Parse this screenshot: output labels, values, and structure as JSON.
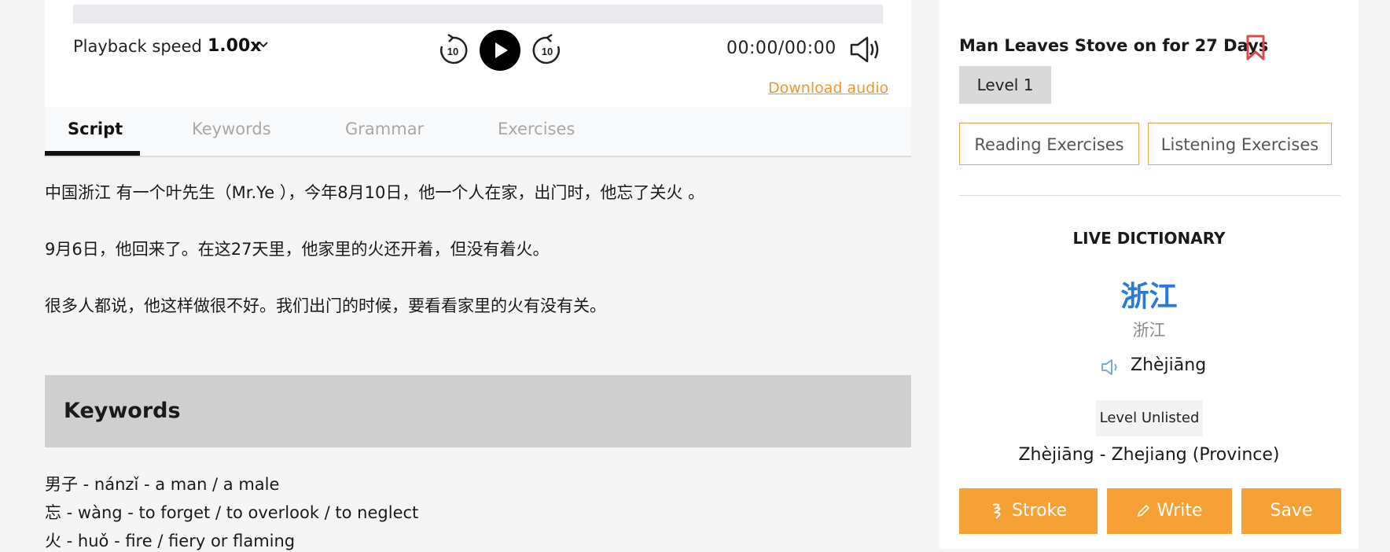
{
  "player": {
    "progress_percent": 0,
    "speed_label": "Playback speed",
    "speed_value": "1.00x",
    "skip_back_label": "10",
    "skip_forward_label": "10",
    "time": "00:00/00:00",
    "download_label": "Download audio"
  },
  "tabs": [
    {
      "label": "Script",
      "active": true
    },
    {
      "label": "Keywords",
      "active": false
    },
    {
      "label": "Grammar",
      "active": false
    },
    {
      "label": "Exercises",
      "active": false
    }
  ],
  "script": [
    "中国浙江 有一个叶先生（Mr.Ye ），今年8月10日，他一个人在家，出门时，他忘了关火 。",
    "9月6日，他回来了。在这27天里，他家里的火还开着，但没有着火。",
    "很多人都说，他这样做很不好。我们出门的时候，要看看家里的火有没有关。"
  ],
  "keywords_section": {
    "title": "Keywords",
    "items": [
      "男子 - nánzǐ - a man / a male",
      "忘 - wàng - to forget / to overlook / to neglect",
      "火 - huǒ - fire / fiery or flaming"
    ]
  },
  "sidebar": {
    "article_title": "Man Leaves Stove on for 27 Days",
    "level": "Level 1",
    "reading_button": "Reading Exercises",
    "listening_button": "Listening Exercises",
    "dictionary": {
      "heading": "LIVE DICTIONARY",
      "word": "浙江",
      "alt_form": "浙江",
      "pinyin": "Zhèjiāng",
      "level": "Level Unlisted",
      "definition": "Zhèjiāng - Zhejiang (Province)"
    },
    "actions": {
      "stroke": "Stroke",
      "write": "Write",
      "save": "Save"
    }
  },
  "colors": {
    "accent": "#f6a135",
    "link": "#f0982f",
    "dictionary_word": "#2a79d6",
    "bookmark": "#d94b4b"
  }
}
